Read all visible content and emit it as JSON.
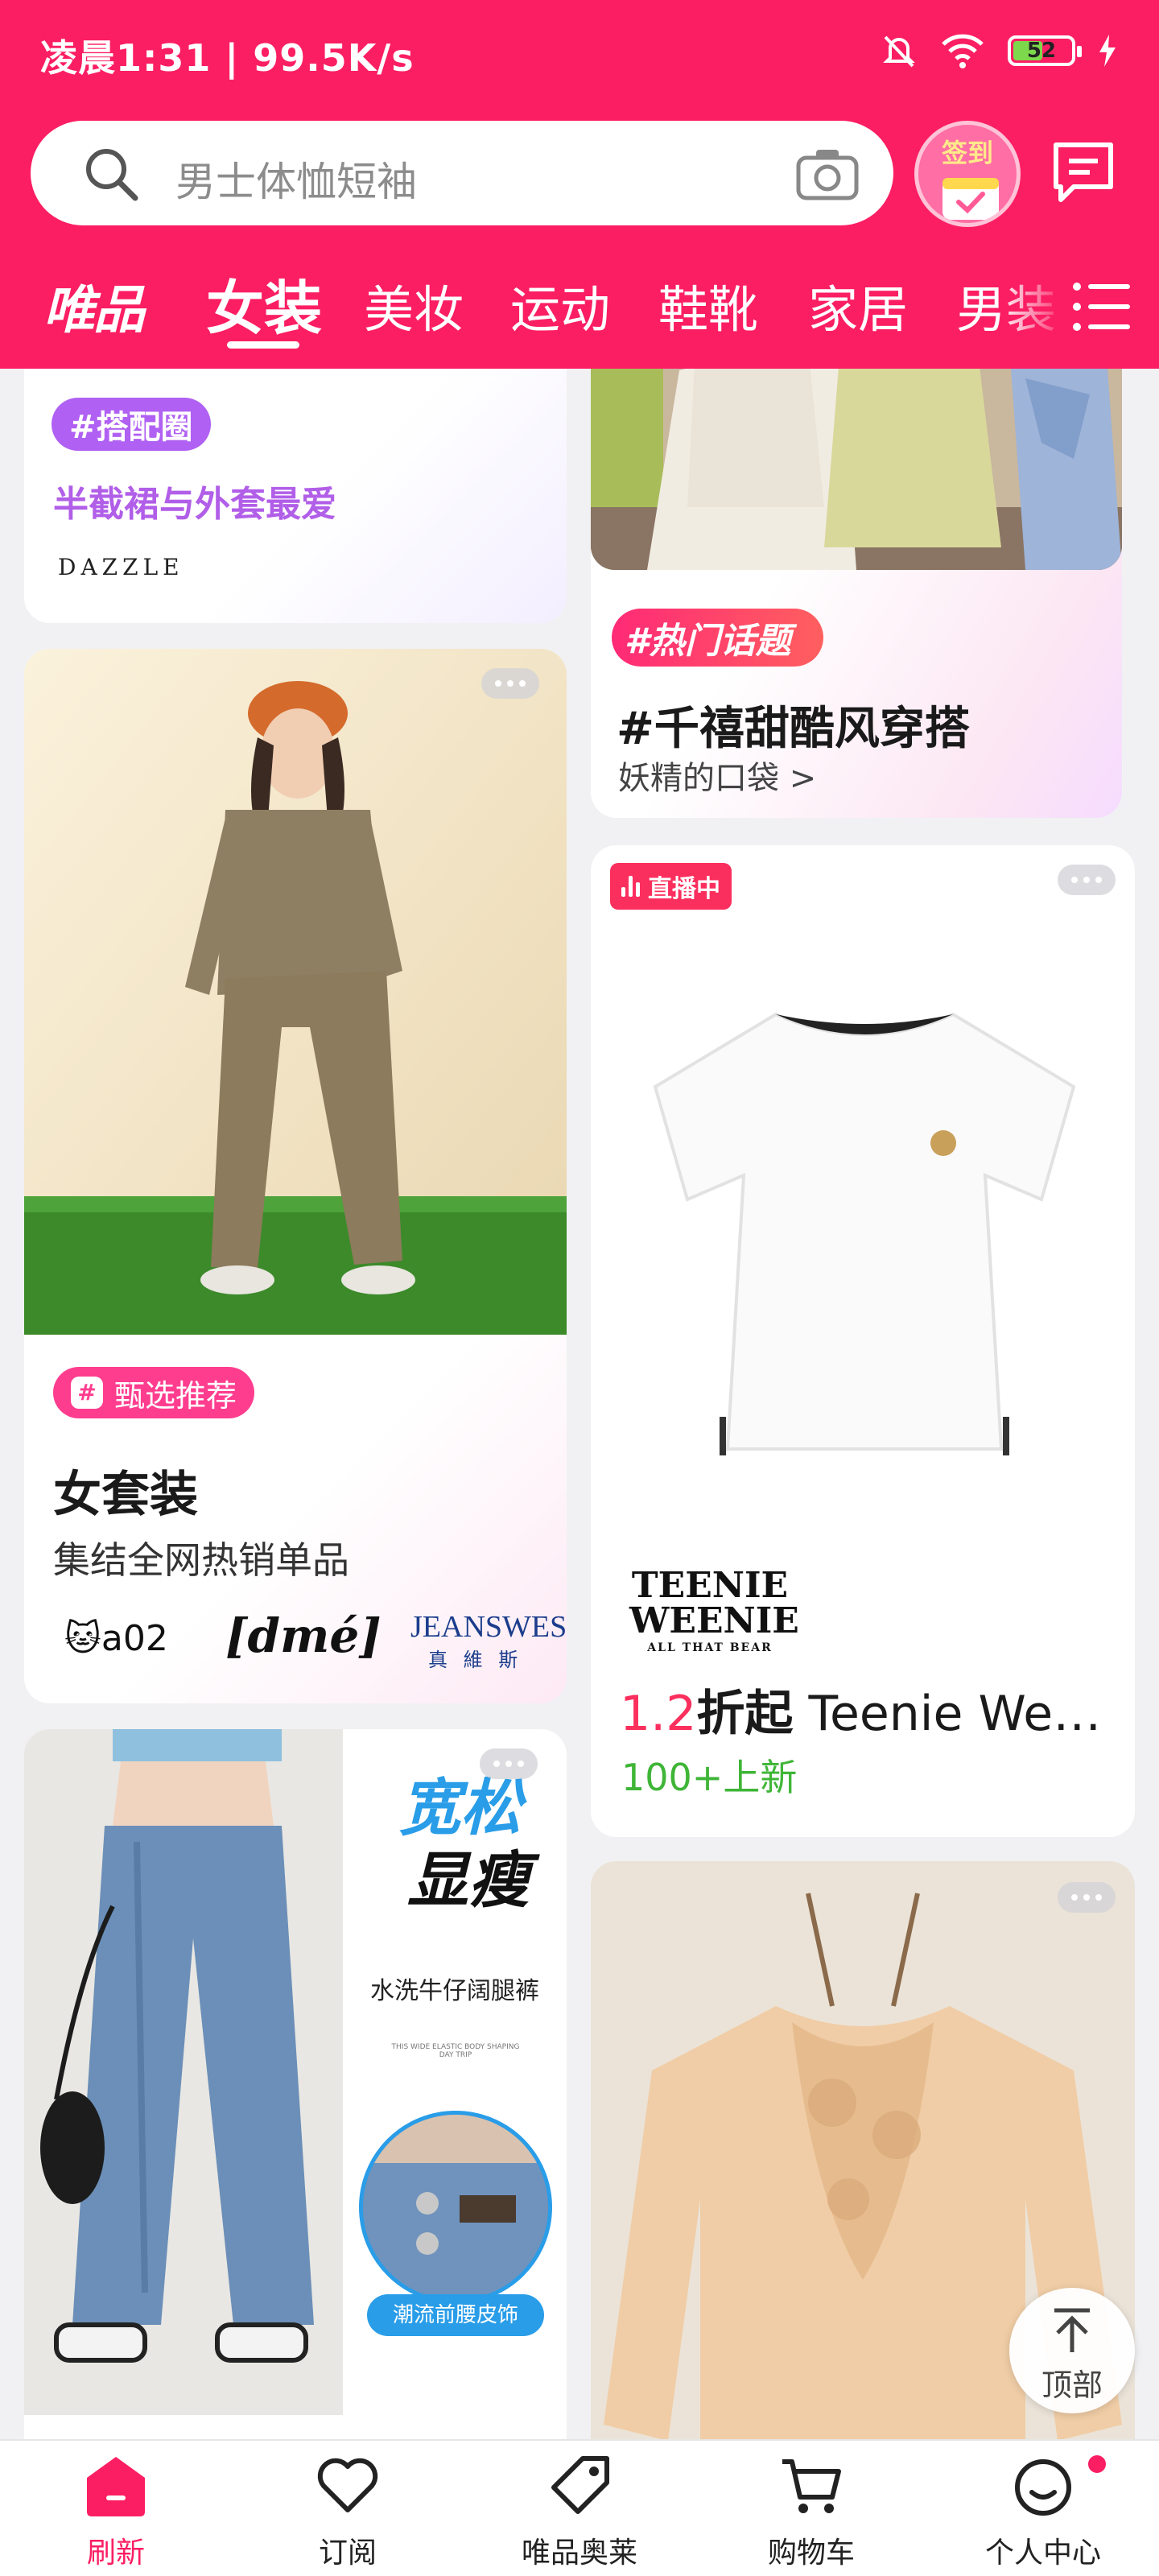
{
  "status_bar": {
    "time_speed": "凌晨1:31 | 99.5K/s",
    "battery": "52"
  },
  "search": {
    "placeholder": "男士体恤短袖"
  },
  "signin": {
    "label": "签到"
  },
  "nav": {
    "brand": "唯品",
    "items": [
      "女装",
      "美妆",
      "运动",
      "鞋靴",
      "家居",
      "男装"
    ],
    "active": "女装"
  },
  "cards": {
    "outfit_circle": {
      "tag": "#搭配圈",
      "subtitle": "半截裙与外套最爱",
      "brand": "DAZZLE"
    },
    "topic": {
      "tag": "#热门话题",
      "title": "#千禧甜酷风穿搭",
      "subtitle": "妖精的口袋 >"
    },
    "women_set": {
      "tag": "甄选推荐",
      "title": "女套装",
      "subtitle": "集结全网热销单品",
      "brands": [
        "a02",
        "[dmé]",
        "JEANSWEST",
        "真 維 斯"
      ]
    },
    "tee_live": {
      "live_tag": "直播中",
      "brand_logo_line1": "TEENIE",
      "brand_logo_line2": "WEENIE",
      "brand_logo_line3": "ALL THAT BEAR",
      "price_num": "1.2",
      "price_unit": "折起",
      "brand_name": " Teenie Weenie 小熊",
      "new_count": "100+上新"
    },
    "jeans_ad": {
      "headline_1": "宽松",
      "headline_2": "显瘦",
      "product": "水洗牛仔阔腿裤",
      "fine_print": "THIS WIDE ELASTIC BODY SHAPING DAY TRIP",
      "detail_label": "潮流前腰皮饰"
    }
  },
  "back_to_top": "顶部",
  "tabbar": {
    "items": [
      {
        "label": "刷新",
        "icon": "home-icon"
      },
      {
        "label": "订阅",
        "icon": "heart-icon"
      },
      {
        "label": "唯品奥莱",
        "icon": "tag-icon"
      },
      {
        "label": "购物车",
        "icon": "cart-icon"
      },
      {
        "label": "个人中心",
        "icon": "smiley-icon"
      }
    ],
    "active": "刷新"
  },
  "colors": {
    "brand_pink": "#fb1e63",
    "purple_tag": "#b060f2",
    "green_text": "#3fb537"
  }
}
